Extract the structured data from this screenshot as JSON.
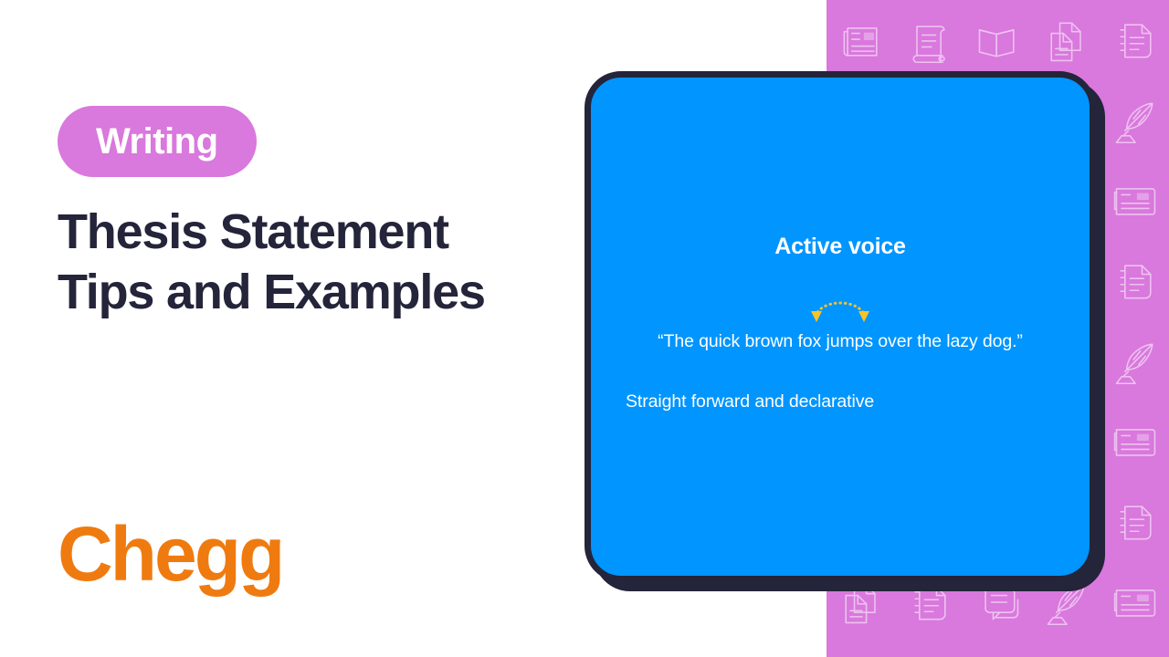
{
  "page": {
    "background_color": "#ffffff",
    "accent_purple": "#d978dd",
    "accent_blue": "#0095ff",
    "accent_dark": "#24243a",
    "accent_orange": "#ef7b10",
    "accent_yellow": "#f9c226"
  },
  "left": {
    "category_label": "Writing",
    "title_line_1": "Thesis Statement",
    "title_line_2": "Tips and Examples",
    "brand": "Chegg"
  },
  "card": {
    "heading": "Active voice",
    "quote": "“The quick brown fox jumps over the lazy dog.”",
    "note": "Straight forward and declarative",
    "arrow_icon": "dotted-arc-double-arrow-icon"
  },
  "pattern": {
    "icons": [
      "newspaper-icon",
      "scroll-icon",
      "open-book-icon",
      "copy-documents-icon",
      "notebook-icon",
      "newspaper-icon",
      "scroll-icon",
      "open-book-icon",
      "copy-documents-icon",
      "quill-pen-icon",
      "newspaper-icon",
      "scroll-icon",
      "open-book-icon",
      "copy-documents-icon",
      "article-card-icon",
      "newspaper-icon",
      "scroll-icon",
      "open-book-icon",
      "copy-documents-icon",
      "notebook-icon",
      "newspaper-icon",
      "scroll-icon",
      "open-book-icon",
      "copy-documents-icon",
      "quill-pen-icon",
      "newspaper-icon",
      "scroll-icon",
      "open-book-icon",
      "copy-documents-icon",
      "article-card-icon",
      "newspaper-icon",
      "scroll-icon",
      "chat-bubbles-icon",
      "quill-pen-icon",
      "notebook-icon",
      "copy-documents-icon",
      "notebook-icon",
      "chat-bubbles-icon",
      "quill-pen-icon",
      "article-card-icon"
    ]
  }
}
